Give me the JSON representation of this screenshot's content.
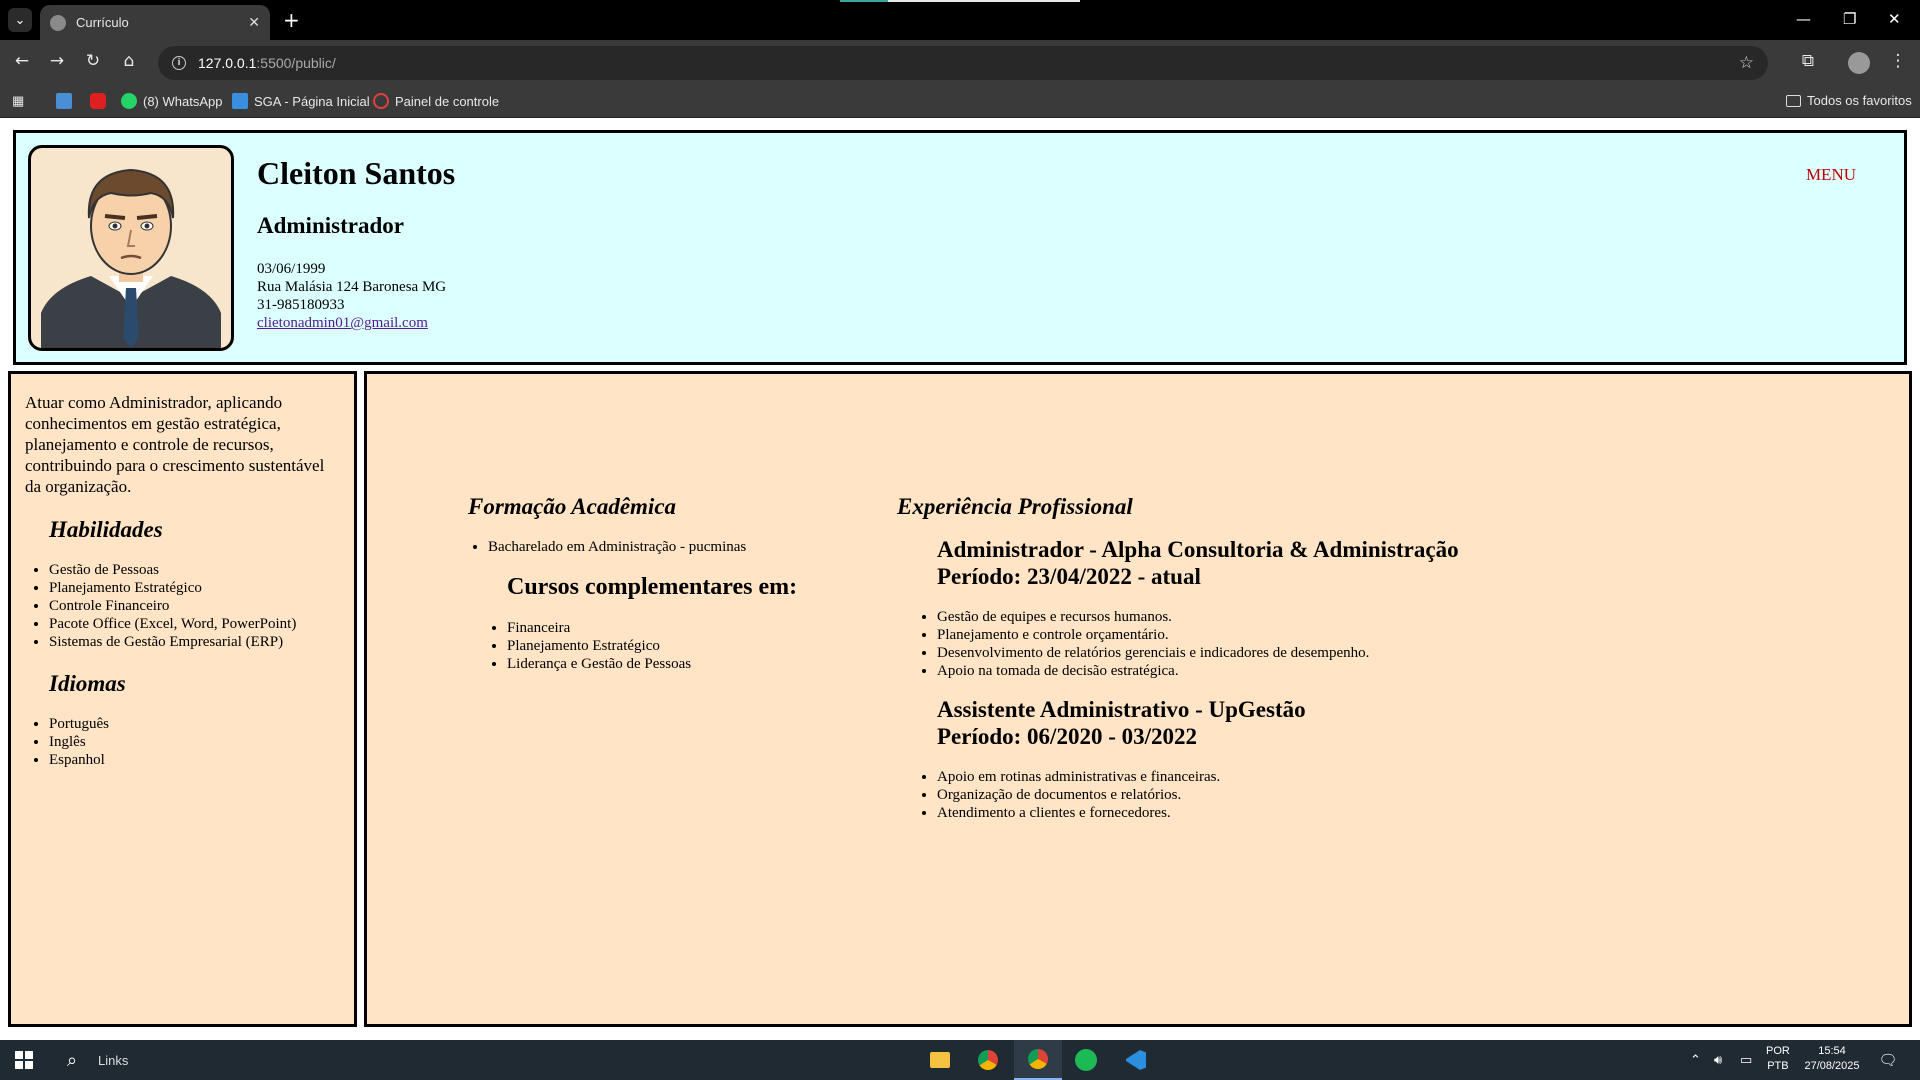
{
  "browser": {
    "tab_title": "Currículo",
    "url_host": "127.0.0.1",
    "url_path": ":5500/public/",
    "bookmarks": [
      {
        "label": "(8) WhatsApp"
      },
      {
        "label": "SGA - Página Inicial"
      },
      {
        "label": "Painel de controle"
      }
    ],
    "all_bookmarks": "Todos os favoritos"
  },
  "header": {
    "name": "Cleiton Santos",
    "role": "Administrador",
    "birth_date": "03/06/1999",
    "address": "Rua Malásia 124 Baronesa MG",
    "phone": "31-985180933",
    "email": "clietonadmin01@gmail.com",
    "menu": "MENU"
  },
  "sidebar": {
    "objective": "Atuar como Administrador, aplicando conhecimentos em gestão estratégica, planejamento e controle de recursos, contribuindo para o crescimento sustentável da organização.",
    "skills_title": "Habilidades",
    "skills": [
      "Gestão de Pessoas",
      "Planejamento Estratégico",
      "Controle Financeiro",
      "Pacote Office (Excel, Word, PowerPoint)",
      "Sistemas de Gestão Empresarial (ERP)"
    ],
    "languages_title": "Idiomas",
    "languages": [
      "Português",
      "Inglês",
      "Espanhol"
    ]
  },
  "education": {
    "title": "Formação Acadêmica",
    "degree": "Bacharelado em Administração - pucminas",
    "courses_title": "Cursos complementares em:",
    "courses": [
      "Financeira",
      "Planejamento Estratégico",
      "Liderança e Gestão de Pessoas"
    ]
  },
  "experience": {
    "title": "Experiência Profissional",
    "jobs": [
      {
        "title": "Administrador - Alpha Consultoria & Administração",
        "period": "Período: 23/04/2022 - atual",
        "tasks": [
          "Gestão de equipes e recursos humanos.",
          "Planejamento e controle orçamentário.",
          "Desenvolvimento de relatórios gerenciais e indicadores de desempenho.",
          "Apoio na tomada de decisão estratégica."
        ]
      },
      {
        "title": "Assistente Administrativo - UpGestão",
        "period": "Período: 06/2020 - 03/2022",
        "tasks": [
          "Apoio em rotinas administrativas e financeiras.",
          "Organização de documentos e relatórios.",
          "Atendimento a clientes e fornecedores."
        ]
      }
    ]
  },
  "taskbar": {
    "search_label": "Links",
    "lang_top": "POR",
    "lang_bottom": "PTB",
    "time": "15:54",
    "date": "27/08/2025"
  }
}
